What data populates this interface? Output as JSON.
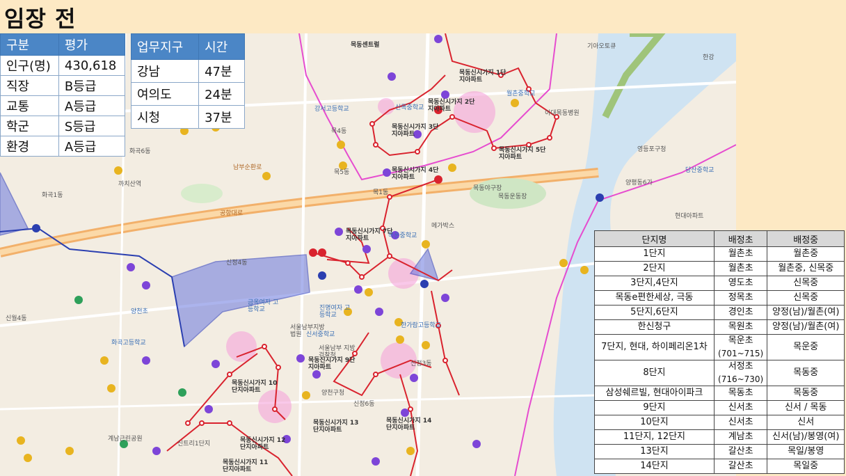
{
  "title": "임장 전",
  "stats_table": {
    "headers": [
      "구분",
      "평가"
    ],
    "rows": [
      [
        "인구(명)",
        "430,618"
      ],
      [
        "직장",
        "B등급"
      ],
      [
        "교통",
        "A등급"
      ],
      [
        "학군",
        "S등급"
      ],
      [
        "환경",
        "A등급"
      ]
    ]
  },
  "commute_table": {
    "headers": [
      "업무지구",
      "시간"
    ],
    "rows": [
      [
        "강남",
        "47분"
      ],
      [
        "여의도",
        "24분"
      ],
      [
        "시청",
        "37분"
      ]
    ]
  },
  "school_table": {
    "headers": [
      "단지명",
      "배정초",
      "배정중"
    ],
    "rows": [
      {
        "name": "1단지",
        "elem": "월촌초",
        "elem_sub": "",
        "mid": "월촌중"
      },
      {
        "name": "2단지",
        "elem": "월촌초",
        "elem_sub": "",
        "mid": "월촌중, 신목중"
      },
      {
        "name": "3단지,4단지",
        "elem": "영도초",
        "elem_sub": "",
        "mid": "신목중"
      },
      {
        "name": "목동e편한세상, 극동",
        "elem": "정목초",
        "elem_sub": "",
        "mid": "신목중"
      },
      {
        "name": "5단지,6단지",
        "elem": "경인초",
        "elem_sub": "",
        "mid": "양정(남)/월촌(여)"
      },
      {
        "name": "한신청구",
        "elem": "목원초",
        "elem_sub": "",
        "mid": "양정(남)/월촌(여)"
      },
      {
        "name": "7단지, 현대, 하이페리온1차",
        "elem": "목운초",
        "elem_sub": "(701~715)",
        "mid": "목운중"
      },
      {
        "name": "8단지",
        "elem": "서정초",
        "elem_sub": "(716~730)",
        "mid": "목동중"
      },
      {
        "name": "삼성쉐르빌, 현대아이파크",
        "elem": "목동초",
        "elem_sub": "",
        "mid": "목동중"
      },
      {
        "name": "9단지",
        "elem": "신서초",
        "elem_sub": "",
        "mid": "신서 / 목동"
      },
      {
        "name": "10단지",
        "elem": "신서초",
        "elem_sub": "",
        "mid": "신서"
      },
      {
        "name": "11단지, 12단지",
        "elem": "계남초",
        "elem_sub": "",
        "mid": "신서(남)/봉영(여)"
      },
      {
        "name": "13단지",
        "elem": "갈산초",
        "elem_sub": "",
        "mid": "목일/봉영"
      },
      {
        "name": "14단지",
        "elem": "갈산초",
        "elem_sub": "",
        "mid": "목일중"
      }
    ]
  },
  "map": {
    "labels": [
      {
        "t": "목동센트럴",
        "k": ""
      },
      {
        "t": "목동신시가지 1단지아파트",
        "k": "bold"
      },
      {
        "t": "목동신시가지 2단지아파트",
        "k": "bold"
      },
      {
        "t": "목동신시가지 3단지아파트",
        "k": "bold"
      },
      {
        "t": "목동신시가지 4단지아파트",
        "k": "bold"
      },
      {
        "t": "목동신시가지 5단지아파트",
        "k": "bold"
      },
      {
        "t": "목동신시가지 7단지아파트",
        "k": "bold"
      },
      {
        "t": "목동신시가지 9단지아파트",
        "k": "bold"
      },
      {
        "t": "목동신시가지 10단지아파트",
        "k": "bold"
      },
      {
        "t": "목동신시가지 12단지아파트",
        "k": "bold"
      },
      {
        "t": "목동신시가지 13단지아파트",
        "k": "bold"
      },
      {
        "t": "목동신시가지 14단지아파트",
        "k": "bold"
      },
      {
        "t": "목동신시가지 11단지아파트",
        "k": "bold"
      },
      {
        "t": "목동운동장",
        "k": ""
      },
      {
        "t": "목동야구장",
        "k": ""
      },
      {
        "t": "메가박스",
        "k": ""
      },
      {
        "t": "양천구청",
        "k": ""
      },
      {
        "t": "신정6동",
        "k": ""
      },
      {
        "t": "신정3동",
        "k": ""
      },
      {
        "t": "신정4동",
        "k": ""
      },
      {
        "t": "목4동",
        "k": ""
      },
      {
        "t": "목5동",
        "k": ""
      },
      {
        "t": "목1동",
        "k": ""
      },
      {
        "t": "화곡6동",
        "k": ""
      },
      {
        "t": "화곡1동",
        "k": ""
      },
      {
        "t": "까치산역",
        "k": ""
      },
      {
        "t": "공항대로",
        "k": "road"
      },
      {
        "t": "남부순환로",
        "k": "road"
      },
      {
        "t": "금옥여자 고등학교",
        "k": "school"
      },
      {
        "t": "강서고등학교",
        "k": "school"
      },
      {
        "t": "진명여자 고등학교",
        "k": "school"
      },
      {
        "t": "신목중학교",
        "k": "school"
      },
      {
        "t": "월촌중학교",
        "k": "school"
      },
      {
        "t": "목운중학교",
        "k": "school"
      },
      {
        "t": "신서중학교",
        "k": "school"
      },
      {
        "t": "한가람고등학교",
        "k": "school"
      },
      {
        "t": "양천초",
        "k": "school"
      },
      {
        "t": "이대목동병원",
        "k": ""
      },
      {
        "t": "서울남부지방법원",
        "k": ""
      },
      {
        "t": "기아오토큐",
        "k": ""
      },
      {
        "t": "당산중학교",
        "k": "school"
      },
      {
        "t": "양평동6가",
        "k": ""
      },
      {
        "t": "현대아파트",
        "k": ""
      },
      {
        "t": "신트리1단지",
        "k": ""
      },
      {
        "t": "계남근린공원",
        "k": ""
      },
      {
        "t": "신월4동",
        "k": ""
      },
      {
        "t": "화곡고등학교",
        "k": "school"
      },
      {
        "t": "서울남부 지방검찰청",
        "k": ""
      },
      {
        "t": "영등포구청",
        "k": ""
      },
      {
        "t": "한강",
        "k": ""
      }
    ]
  }
}
